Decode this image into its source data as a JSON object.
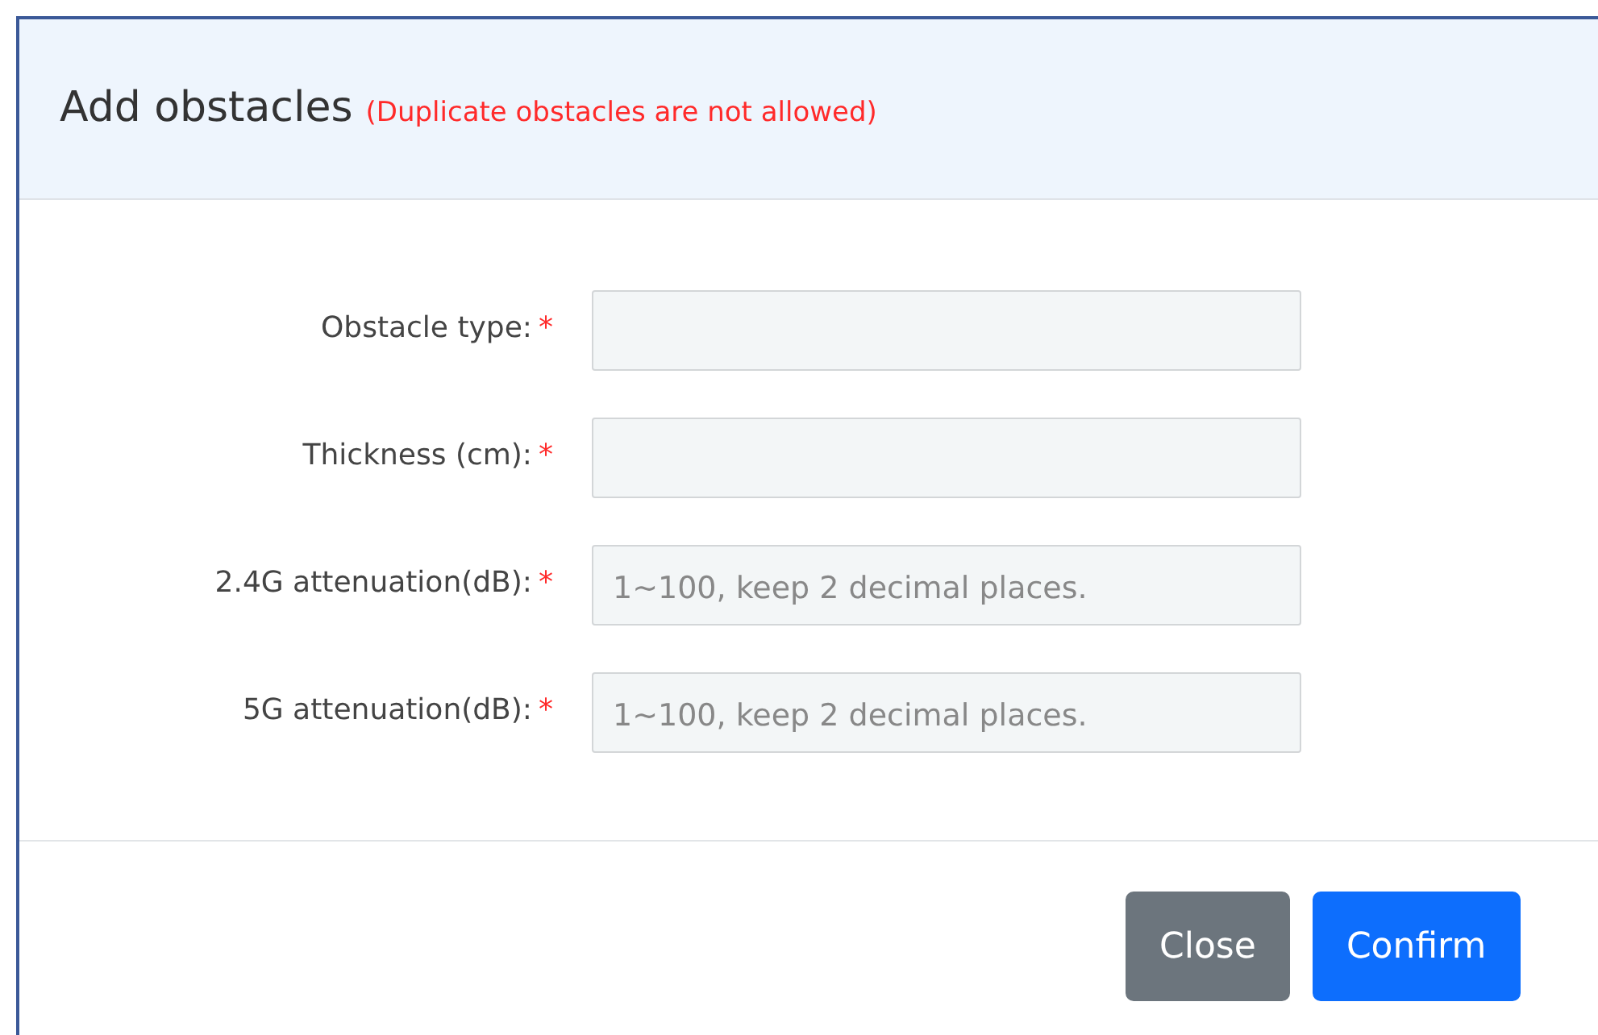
{
  "dialog": {
    "title": "Add obstacles",
    "note": "(Duplicate obstacles are not allowed)"
  },
  "fields": [
    {
      "label": "Obstacle type:",
      "required_mark": "*"
    },
    {
      "label": "Thickness (cm):",
      "required_mark": "*"
    },
    {
      "label": "2.4G attenuation(dB):",
      "required_mark": "*",
      "placeholder": "1~100, keep 2 decimal places."
    },
    {
      "label": "5G attenuation(dB):",
      "required_mark": "*",
      "placeholder": "1~100, keep 2 decimal places."
    }
  ],
  "buttons": [
    {
      "label": "Close",
      "kind": "secondary"
    },
    {
      "label": "Confirm",
      "kind": "primary"
    }
  ]
}
